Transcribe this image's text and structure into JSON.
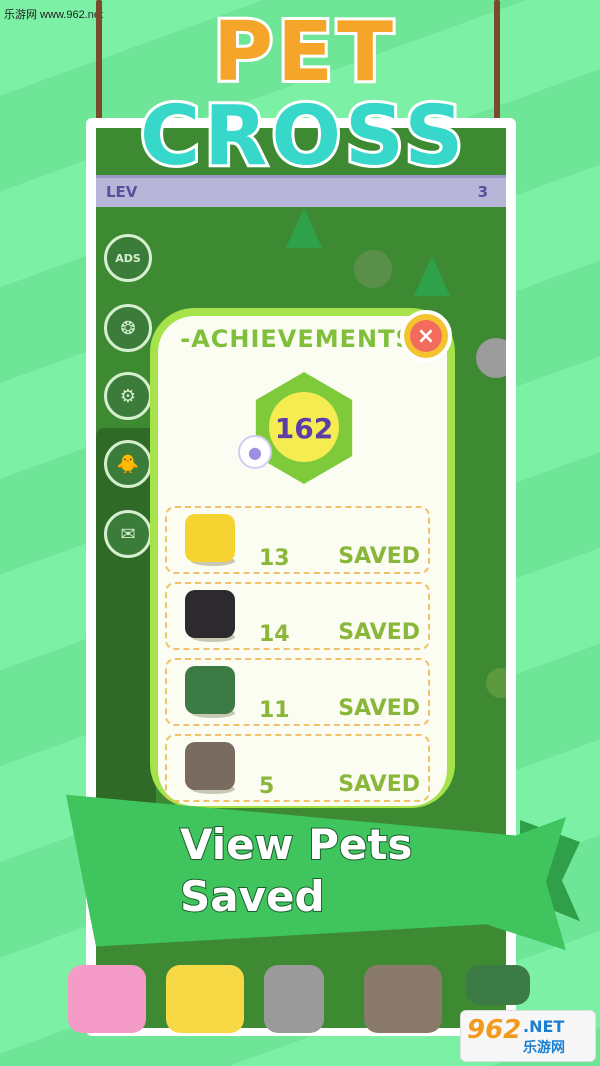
{
  "watermark": "乐游网 www.962.net",
  "logo": {
    "word1": "PET",
    "word2": "CROSS"
  },
  "topbar": {
    "level_label": "LEV",
    "level_value": "3"
  },
  "side_buttons": [
    "ADS",
    "❂",
    "⚙",
    "🐥",
    "✉"
  ],
  "achievements": {
    "title": "-ACHIEVEMENTS-",
    "total": "162",
    "close_label": "×",
    "rows": [
      {
        "pet": "chick",
        "count": "13",
        "label": "SAVED",
        "color": "#f5d432"
      },
      {
        "pet": "boar",
        "count": "14",
        "label": "SAVED",
        "color": "#2d2a2f"
      },
      {
        "pet": "duck",
        "count": "11",
        "label": "SAVED",
        "color": "#3c7b45"
      },
      {
        "pet": "dog",
        "count": "5",
        "label": "SAVED",
        "color": "#7a6b60"
      }
    ]
  },
  "banner": {
    "line1": "View Pets",
    "line2": "Saved"
  },
  "bottom_animals": [
    {
      "name": "pig",
      "color": "#f59bc7"
    },
    {
      "name": "chick",
      "color": "#f7d845"
    },
    {
      "name": "rabbit",
      "color": "#9a9a9a"
    },
    {
      "name": "goat",
      "color": "#8a7a6c"
    },
    {
      "name": "duck",
      "color": "#3c7b45"
    }
  ],
  "site_logo": {
    "main": "962",
    "net": ".NET",
    "cn": "乐游网"
  }
}
